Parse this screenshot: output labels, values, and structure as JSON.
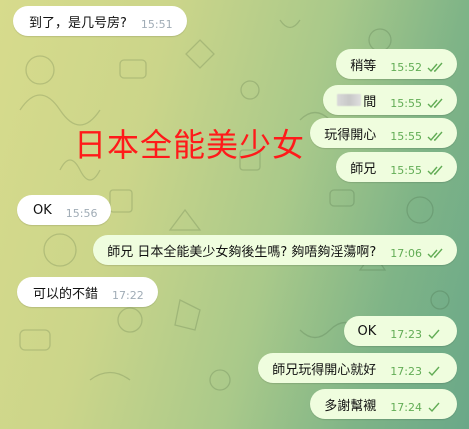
{
  "overlay_title": "日本全能美少女",
  "colors": {
    "incoming_bubble": "#ffffff",
    "outgoing_bubble": "#effdde",
    "incoming_time": "#a0acb6",
    "outgoing_time": "#62ac55",
    "overlay_title": "#ff1a1a"
  },
  "messages": [
    {
      "dir": "in",
      "text": "到了，是几号房?",
      "time": "15:51"
    },
    {
      "dir": "out",
      "text": "稍等",
      "time": "15:52",
      "status": "read",
      "status_icon": "double-check-icon"
    },
    {
      "dir": "out",
      "text": "間",
      "time": "15:55",
      "status": "read",
      "status_icon": "double-check-icon",
      "redacted_prefix": true
    },
    {
      "dir": "out",
      "text": "玩得開心",
      "time": "15:55",
      "status": "read",
      "status_icon": "double-check-icon"
    },
    {
      "dir": "out",
      "text": "師兄",
      "time": "15:55",
      "status": "read",
      "status_icon": "double-check-icon"
    },
    {
      "dir": "in",
      "text": "OK",
      "time": "15:56"
    },
    {
      "dir": "out",
      "text": "師兄 日本全能美少女夠後生嗎? 夠唔夠淫蕩啊?",
      "time": "17:06",
      "status": "read",
      "status_icon": "double-check-icon"
    },
    {
      "dir": "in",
      "text": "可以的不錯",
      "time": "17:22"
    },
    {
      "dir": "out",
      "text": "OK",
      "time": "17:23",
      "status": "sent",
      "status_icon": "single-check-icon"
    },
    {
      "dir": "out",
      "text": "師兄玩得開心就好",
      "time": "17:23",
      "status": "sent",
      "status_icon": "single-check-icon"
    },
    {
      "dir": "out",
      "text": "多謝幫襯",
      "time": "17:24",
      "status": "sent",
      "status_icon": "single-check-icon"
    }
  ]
}
